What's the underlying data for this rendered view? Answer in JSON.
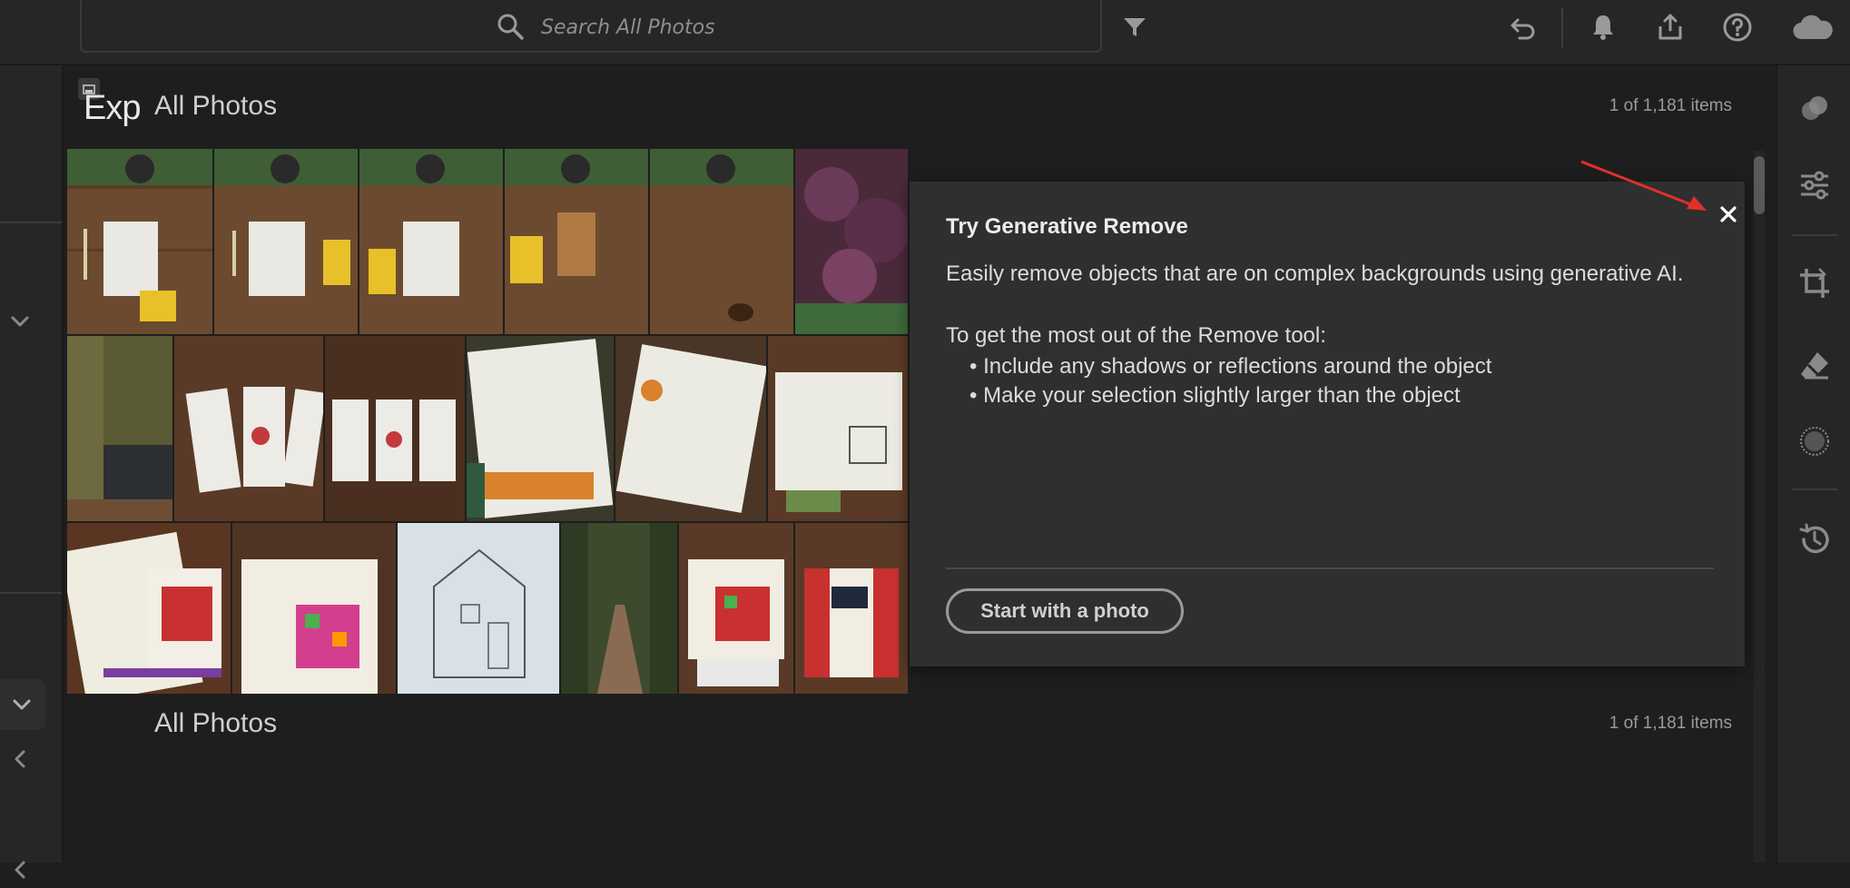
{
  "search": {
    "placeholder": "Search All Photos"
  },
  "header": {
    "partial_title": "Exp",
    "section_title": "All Photos",
    "item_count": "1 of 1,181 items"
  },
  "second_section": {
    "title": "All Photos",
    "item_count": "1 of 1,181 items"
  },
  "toolbar_icons": [
    "filter-icon",
    "undo-icon",
    "bell-icon",
    "share-icon",
    "help-icon",
    "cloud-icon"
  ],
  "right_panel_icons": [
    "color-mix-icon",
    "edit-sliders-icon",
    "crop-icon",
    "remove-eraser-icon",
    "masking-icon",
    "history-icon"
  ],
  "coach": {
    "title": "Try Generative Remove",
    "intro": "Easily remove objects that are on complex backgrounds using generative AI.",
    "subheading": "To get the most out of the Remove tool:",
    "bullets": [
      "Include any shadows or reflections around the object",
      "Make your selection slightly larger than the object"
    ],
    "button_label": "Start with a photo"
  },
  "photos": [
    {
      "row": 0,
      "subject": "wood desk with notebook, keys, yellow card",
      "palette": "wood"
    },
    {
      "row": 0,
      "subject": "wood desk with notebook, keys, yellow card",
      "palette": "wood"
    },
    {
      "row": 0,
      "subject": "wood desk with notebook, keys, yellow card",
      "palette": "wood"
    },
    {
      "row": 0,
      "subject": "wood desk with tan notebook",
      "palette": "wood"
    },
    {
      "row": 0,
      "subject": "empty wood desk with keys",
      "palette": "wood"
    },
    {
      "row": 0,
      "subject": "purple leaves tree",
      "palette": "purple"
    },
    {
      "row": 1,
      "subject": "forest creek",
      "palette": "forest"
    },
    {
      "row": 1,
      "subject": "tarot style cards on table",
      "palette": "wood"
    },
    {
      "row": 1,
      "subject": "tarot style cards on table",
      "palette": "wood"
    },
    {
      "row": 1,
      "subject": "journal with flowers",
      "palette": "journal"
    },
    {
      "row": 1,
      "subject": "journal pages sketch",
      "palette": "journal"
    },
    {
      "row": 1,
      "subject": "journal house sketch",
      "palette": "journal"
    },
    {
      "row": 2,
      "subject": "bingo journal page",
      "palette": "bingo"
    },
    {
      "row": 2,
      "subject": "bingo journal page",
      "palette": "bingo"
    },
    {
      "row": 2,
      "subject": "house pencil sketch",
      "palette": "sketch"
    },
    {
      "row": 2,
      "subject": "forest path",
      "palette": "forest"
    },
    {
      "row": 2,
      "subject": "bingo journal with clips",
      "palette": "bingo"
    },
    {
      "row": 2,
      "subject": "theater curtain journal page",
      "palette": "theater"
    }
  ]
}
